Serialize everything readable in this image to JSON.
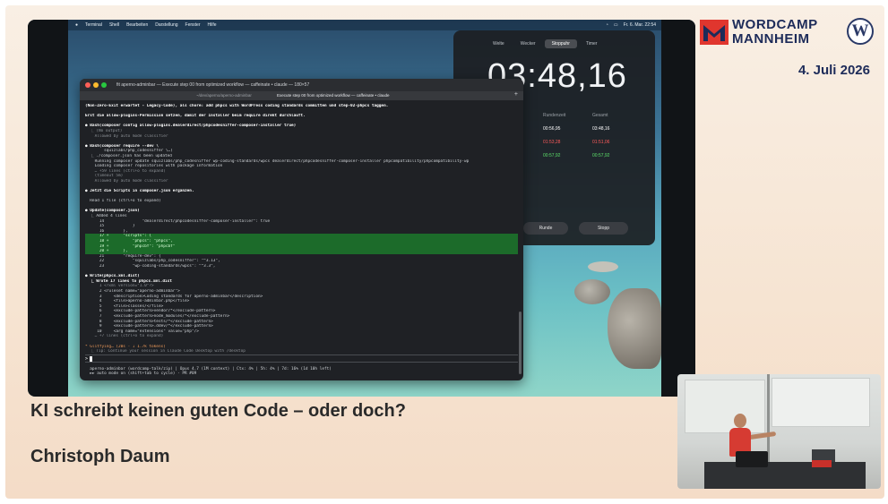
{
  "brand": {
    "line1": "WORDCAMP",
    "line2": "MANNHEIM",
    "date": "4. Juli 2026",
    "colors": {
      "primary": "#1d2b59",
      "accent": "#e0362e"
    }
  },
  "menubar": {
    "items": [
      "Terminal",
      "Shell",
      "Bearbeiten",
      "Darstellung",
      "Fenster",
      "Hilfe"
    ],
    "clock": "Fr. 6. Mar. 22:54"
  },
  "stopwatch": {
    "tabs": [
      "Welte",
      "Wecker",
      "Stoppuhr",
      "Timer"
    ],
    "active_tab": "Stoppuhr",
    "time": "03:48,16",
    "columns": [
      "Runde",
      "Rundenzeit",
      "Gesamt"
    ],
    "rows": [
      {
        "lap": "00:56,95",
        "total": "03:48,16",
        "color": "white"
      },
      {
        "lap": "01:53,28",
        "total": "01:51,06",
        "color": "red"
      },
      {
        "lap": "00:57,92",
        "total": "00:57,92",
        "color": "green"
      }
    ],
    "btn_left": "Runde",
    "btn_right": "Stopp"
  },
  "terminal": {
    "title": "fit aperno-adminbar — Execute step 00 from optimized workflow — caffeinate • claude — 180×57",
    "tab_path": "~/dev/aperno/aperno-adminbar",
    "tab_active": "Execute step 00 from optimized workflow — caffeinate • claude",
    "lines": [
      {
        "t": "(Non-Zero-Exit erwartet - Legacy-Code), als chore: add phpcs with WordPress coding standards committen und step-02-phpcs taggen.",
        "c": "bold"
      },
      {
        "t": "",
        "c": ""
      },
      {
        "t": "Erst die allow-plugins-Permission setzen, damit der Installer beim require direkt durchläuft.",
        "c": "bold"
      },
      {
        "t": "",
        "c": ""
      },
      {
        "t": "● Bash(composer config allow-plugins.dealerdirect/phpcodesniffer-composer-installer true)",
        "c": "bold"
      },
      {
        "t": "  ⎿ (No output)",
        "c": "dim"
      },
      {
        "t": "    Allowed by auto mode classifier",
        "c": "dim"
      },
      {
        "t": "",
        "c": ""
      },
      {
        "t": "● Bash(composer require --dev \\",
        "c": "bold"
      },
      {
        "t": "        squizlabs/php_codesniffer \\…)",
        "c": ""
      },
      {
        "t": "  ⎿ ./composer.json has been updated",
        "c": ""
      },
      {
        "t": "    Running composer update squizlabs/php_codesniffer wp-coding-standards/wpcs dealerdirect/phpcodesniffer-composer-installer phpcompatibility/phpcompatibility-wp",
        "c": ""
      },
      {
        "t": "    Loading composer repositories with package information",
        "c": ""
      },
      {
        "t": "    … +59 lines (ctrl+o to expand)",
        "c": "dim"
      },
      {
        "t": "    (timeout 5m)",
        "c": "dim"
      },
      {
        "t": "    Allowed by auto mode classifier",
        "c": "dim"
      },
      {
        "t": "",
        "c": ""
      },
      {
        "t": "● Jetzt die Scripts in composer.json ergänzen.",
        "c": "bold"
      },
      {
        "t": "",
        "c": ""
      },
      {
        "t": "  Read 1 file (ctrl+o to expand)",
        "c": ""
      },
      {
        "t": "",
        "c": ""
      },
      {
        "t": "● Update(composer.json)",
        "c": "bold"
      },
      {
        "t": "  ⎿ Added 4 lines",
        "c": ""
      },
      {
        "t": "      14                \"dealerdirect/phpcodesniffer-composer-installer\": true",
        "c": ""
      },
      {
        "t": "      15            }",
        "c": ""
      },
      {
        "t": "      16        },",
        "c": ""
      },
      {
        "t": "      17 +      \"scripts\": {",
        "c": "green"
      },
      {
        "t": "      18 +          \"phpcs\": \"phpcs\",",
        "c": "green"
      },
      {
        "t": "      19 +          \"phpcbf\": \"phpcbf\"",
        "c": "green"
      },
      {
        "t": "      20 +      },",
        "c": "green"
      },
      {
        "t": "      21        \"require-dev\": {",
        "c": ""
      },
      {
        "t": "      22            \"squizlabs/php_codesniffer\": \"^3.13\",",
        "c": ""
      },
      {
        "t": "      23            \"wp-coding-standards/wpcs\": \"^3.3\",",
        "c": ""
      },
      {
        "t": "",
        "c": ""
      },
      {
        "t": "● Write(phpcs.xml.dist)",
        "c": "bold"
      },
      {
        "t": "  ⎿ Wrote 17 lines to phpcs.xml.dist",
        "c": "bold"
      },
      {
        "t": "      1 <?xml version=\"1.0\"?>",
        "c": "dim"
      },
      {
        "t": "      2 <ruleset name=\"aperno-adminbar\">",
        "c": ""
      },
      {
        "t": "      3     <description>Coding standards for aperno-adminbar</description>",
        "c": ""
      },
      {
        "t": "      4     <file>aperno-adminbar.php</file>",
        "c": ""
      },
      {
        "t": "      5     <file>classes/</file>",
        "c": ""
      },
      {
        "t": "      6     <exclude-pattern>vendor/*</exclude-pattern>",
        "c": ""
      },
      {
        "t": "      7     <exclude-pattern>node_modules/*</exclude-pattern>",
        "c": ""
      },
      {
        "t": "      8     <exclude-pattern>tests/*</exclude-pattern>",
        "c": ""
      },
      {
        "t": "      9     <exclude-pattern>.ddev/*</exclude-pattern>",
        "c": ""
      },
      {
        "t": "     10     <arg name=\"extensions\" value=\"php\"/>",
        "c": ""
      },
      {
        "t": "    … +7 lines (ctrl+o to expand)",
        "c": "dim"
      },
      {
        "t": "",
        "c": ""
      },
      {
        "t": "* Glitfying… (20s · ↓ 1.7k tokens)",
        "c": "orange"
      },
      {
        "t": "  ⎿ Tip: Continue your session in Claude Code Desktop with /desktop",
        "c": "dim"
      }
    ],
    "prompt_symbol": ">",
    "status_line1": "  aperno-adminbar (wordcamp-talk/zip) | Opus 4.7 (1M context) | Ctx: 4% | 5h: 4% | 7d: 16% (1d 10h left)",
    "status_line2": "  ►► auto mode on (shift+tab to cycle) · PR #09"
  },
  "talk": {
    "title": "KI schreibt keinen guten Code – oder doch?",
    "speaker": "Christoph Daum"
  }
}
